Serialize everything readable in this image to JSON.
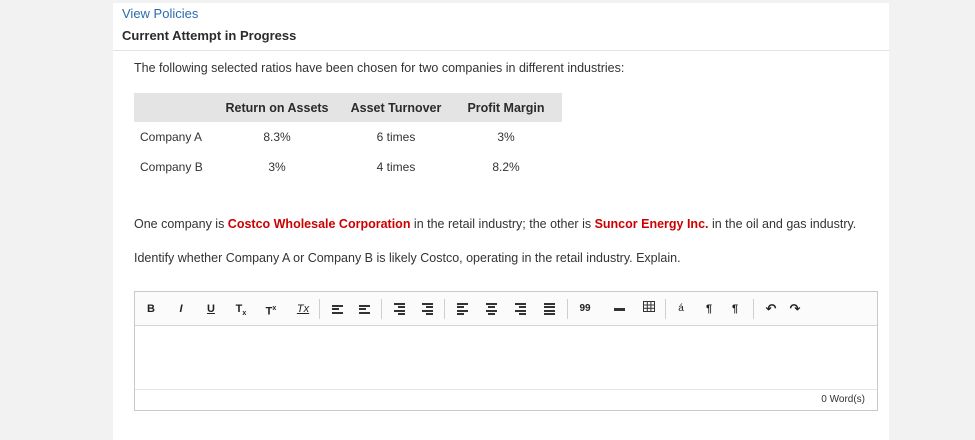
{
  "header": {
    "view_policies": "View Policies",
    "attempt_status": "Current Attempt in Progress"
  },
  "question": {
    "intro": "The following selected ratios have been chosen for two companies in different industries:",
    "table": {
      "headers": [
        "",
        "Return on Assets",
        "Asset Turnover",
        "Profit Margin"
      ],
      "rows": [
        [
          "Company A",
          "8.3%",
          "6 times",
          "3%"
        ],
        [
          "Company B",
          "3%",
          "4 times",
          "8.2%"
        ]
      ]
    },
    "p1_part1": "One company is ",
    "p1_company1": "Costco Wholesale Corporation",
    "p1_part2": " in the retail industry; the other is ",
    "p1_company2": "Suncor Energy Inc.",
    "p1_part3": " in the oil and gas industry.",
    "prompt": "Identify whether Company A or Company B is likely Costco, operating in the retail industry. Explain."
  },
  "editor": {
    "toolbar": {
      "bold": "B",
      "italic": "I",
      "underline": "U",
      "subscript": "T",
      "subscript_mark": "x",
      "superscript": "T",
      "superscript_mark": "x",
      "clear_format": "Tx",
      "blockquote": "99",
      "special_char": "á",
      "ltr": "¶",
      "rtl": "¶",
      "undo": "↶",
      "redo": "↷"
    },
    "word_count": "0 Word(s)"
  },
  "colors": {
    "link": "#2a6bb0",
    "highlight": "#cc0000",
    "table_header_bg": "#e4e4e4"
  }
}
